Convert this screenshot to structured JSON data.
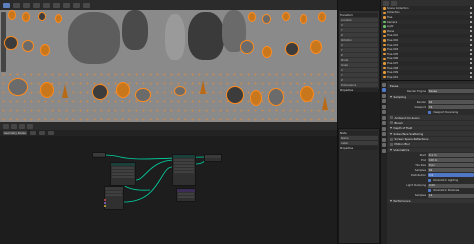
{
  "viewport": {
    "header_modes": [
      "",
      "",
      "",
      "",
      "",
      "",
      "",
      "",
      ""
    ]
  },
  "npanel": {
    "sections": [
      {
        "title": "Transform",
        "rows": [
          "Location",
          "X",
          "Y",
          "Z",
          "Rotation",
          "X",
          "Y",
          "Z",
          "Mode",
          "Scale",
          "X",
          "Y",
          "Z",
          "Dimensions",
          "X",
          "Y",
          "Z"
        ]
      },
      {
        "title": "Properties",
        "rows": []
      }
    ]
  },
  "node_editor": {
    "header": [
      "",
      "",
      "",
      ""
    ],
    "toolbar": [
      "Geometry Nodes",
      "",
      "",
      ""
    ]
  },
  "node_sidebar": {
    "sections": [
      {
        "title": "Node",
        "rows": [
          "Name",
          "Label"
        ]
      },
      {
        "title": "Properties",
        "rows": []
      }
    ]
  },
  "outliner": {
    "header": [
      "",
      ""
    ],
    "items": [
      {
        "label": "Scene Collection",
        "icon": "collection-icon"
      },
      {
        "label": "Collection",
        "icon": "collection-icon"
      },
      {
        "label": "Tree",
        "icon": "object-icon"
      },
      {
        "label": "Camera",
        "icon": "camera-icon"
      },
      {
        "label": "Light",
        "icon": "light-icon"
      },
      {
        "label": "Plane",
        "icon": "object-icon"
      },
      {
        "label": "Tree.001",
        "icon": "object-icon"
      },
      {
        "label": "Tree.002",
        "icon": "object-icon"
      },
      {
        "label": "Tree.003",
        "icon": "object-icon"
      },
      {
        "label": "Tree.004",
        "icon": "object-icon"
      },
      {
        "label": "Tree.005",
        "icon": "object-icon"
      },
      {
        "label": "Tree.006",
        "icon": "object-icon"
      },
      {
        "label": "Tree.007",
        "icon": "object-icon"
      },
      {
        "label": "Tree.008",
        "icon": "object-icon"
      },
      {
        "label": "Tree.009",
        "icon": "object-icon"
      },
      {
        "label": "Tree.010",
        "icon": "object-icon"
      }
    ]
  },
  "properties": {
    "rows": [
      {
        "type": "section",
        "label": "Eevee"
      },
      {
        "type": "field",
        "label": "Render Engine",
        "value": "Eevee"
      },
      {
        "type": "section",
        "label": "Sampling"
      },
      {
        "type": "field",
        "label": "Render",
        "value": "64"
      },
      {
        "type": "field",
        "label": "Viewport",
        "value": "16"
      },
      {
        "type": "check",
        "label": "Viewport Denoising",
        "on": true
      },
      {
        "type": "section",
        "label": "Ambient Occlusion"
      },
      {
        "type": "section",
        "label": "Bloom"
      },
      {
        "type": "section",
        "label": "Depth of Field"
      },
      {
        "type": "section",
        "label": "Subsurface Scattering"
      },
      {
        "type": "section",
        "label": "Screen Space Reflections"
      },
      {
        "type": "section",
        "label": "Motion Blur"
      },
      {
        "type": "section",
        "label": "Volumetrics"
      },
      {
        "type": "field",
        "label": "Start",
        "value": "0.1 m"
      },
      {
        "type": "field",
        "label": "End",
        "value": "100 m"
      },
      {
        "type": "field",
        "label": "Tile Size",
        "value": "8 px"
      },
      {
        "type": "field",
        "label": "Samples",
        "value": "64"
      },
      {
        "type": "field",
        "label": "Distribution",
        "value": "0.8"
      },
      {
        "type": "check",
        "label": "Volumetric Lighting",
        "on": true
      },
      {
        "type": "field",
        "label": "Light Clamping",
        "value": "0.00"
      },
      {
        "type": "check",
        "label": "Volumetric Shadows",
        "on": true
      },
      {
        "type": "field",
        "label": "Samples",
        "value": "16"
      },
      {
        "type": "section",
        "label": "Performance"
      }
    ]
  }
}
